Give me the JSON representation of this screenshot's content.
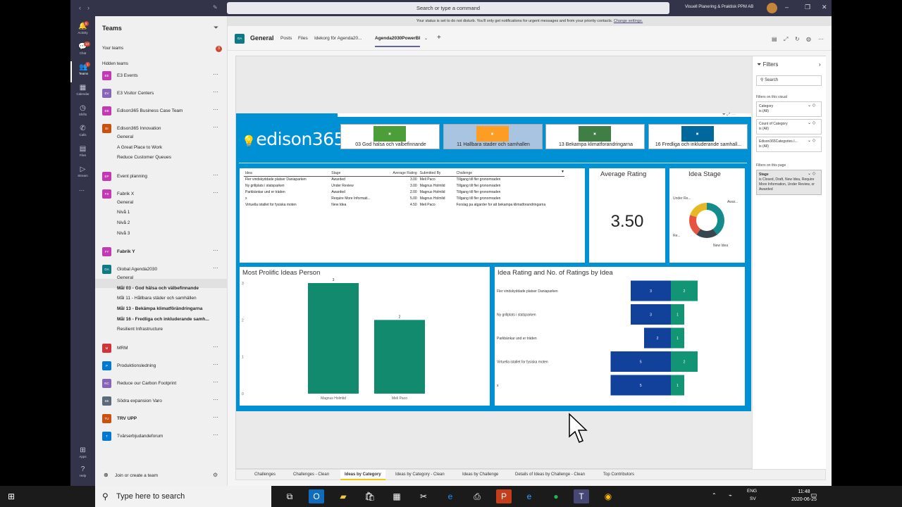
{
  "window": {
    "search_placeholder": "Search or type a command",
    "org": "Visuell Planering & Praktisk PPM AB"
  },
  "rail": [
    {
      "label": "Activity",
      "icon": "bell-icon",
      "badge": "5"
    },
    {
      "label": "Chat",
      "icon": "chat-icon",
      "badge": "12"
    },
    {
      "label": "Teams",
      "icon": "teams-icon",
      "badge": "1"
    },
    {
      "label": "Calendar",
      "icon": "calendar-icon",
      "badge": ""
    },
    {
      "label": "Shifts",
      "icon": "clock-icon",
      "badge": ""
    },
    {
      "label": "Calls",
      "icon": "phone-icon",
      "badge": ""
    },
    {
      "label": "Files",
      "icon": "file-icon",
      "badge": ""
    },
    {
      "label": "Stream",
      "icon": "stream-icon",
      "badge": ""
    }
  ],
  "rail_bottom": [
    {
      "label": "Apps",
      "icon": "apps-icon"
    },
    {
      "label": "Help",
      "icon": "help-icon"
    }
  ],
  "teams_panel": {
    "title": "Teams",
    "your_teams": "Your teams",
    "your_teams_badge": "3",
    "hidden_teams": "Hidden teams",
    "join": "Join or create a team",
    "teams": [
      {
        "name": "E3 Events",
        "abbr": "EE",
        "color": "#c239b3",
        "bold": false
      },
      {
        "name": "E3 Visitor Centers",
        "abbr": "EV",
        "color": "#8764b8",
        "bold": false
      },
      {
        "name": "Edison365 Business Case Team",
        "abbr": "EB",
        "color": "#c239b3",
        "bold": false
      },
      {
        "name": "Edison365 Innovation",
        "abbr": "EI",
        "color": "#ca5010",
        "bold": false,
        "channels": [
          {
            "name": "General",
            "bold": false
          },
          {
            "name": "A Great Place to Work",
            "bold": false
          },
          {
            "name": "Reduce Customer Queues",
            "bold": false
          }
        ]
      },
      {
        "name": "Event planning",
        "abbr": "EP",
        "color": "#c239b3",
        "bold": false
      },
      {
        "name": "Fabrik X",
        "abbr": "FX",
        "color": "#c239b3",
        "bold": false,
        "channels": [
          {
            "name": "General",
            "bold": false
          },
          {
            "name": "Nivå 1",
            "bold": false
          },
          {
            "name": "Nivå 2",
            "bold": false
          },
          {
            "name": "Nivå 3",
            "bold": false
          }
        ]
      },
      {
        "name": "Fabrik Y",
        "abbr": "FY",
        "color": "#c239b3",
        "bold": true
      },
      {
        "name": "Global Agenda2030",
        "abbr": "GA",
        "color": "#0e7a86",
        "bold": false,
        "channels": [
          {
            "name": "General",
            "bold": false,
            "selected": true
          },
          {
            "name": "Mål 03 - God hälsa och välbefinnande",
            "bold": true
          },
          {
            "name": "Mål 11 - Hållbara städer och samhällen",
            "bold": false
          },
          {
            "name": "Mål 13 - Bekämpa klimatförändringarna",
            "bold": true
          },
          {
            "name": "Mål 16 - Fredliga och inkluderande samh...",
            "bold": true
          },
          {
            "name": "Resilient Infrastructure",
            "bold": false
          }
        ]
      },
      {
        "name": "MRM",
        "abbr": "M",
        "color": "#d13438",
        "bold": false
      },
      {
        "name": "Produktionsledning",
        "abbr": "P",
        "color": "#0078d4",
        "bold": false
      },
      {
        "name": "Reduce our Carbon Footprint",
        "abbr": "RC",
        "color": "#8764b8",
        "bold": false
      },
      {
        "name": "Södra expansion Varo",
        "abbr": "SE",
        "color": "#5a6a7a",
        "bold": false
      },
      {
        "name": "TRV UPP",
        "abbr": "TU",
        "color": "#ca5010",
        "bold": true
      },
      {
        "name": "Tvärserbjudandeforum",
        "abbr": "T",
        "color": "#0078d4",
        "bold": false
      }
    ]
  },
  "notice": {
    "text": "Your status is set to do not disturb. You'll only get notifications for urgent messages and from your priority contacts.",
    "link": "Change settings."
  },
  "channel": {
    "abbr": "GA",
    "name": "General",
    "tabs": [
      "Posts",
      "Files",
      "Idekorg för Agenda20...",
      "Agenda2030PowerBI"
    ],
    "active_tab": "Agenda2030PowerBI"
  },
  "report": {
    "logo": "edison365",
    "goals": [
      {
        "label": "03 God halsa och valbefinnande",
        "color": "#4c9f38",
        "selected": false
      },
      {
        "label": "11 Hallbara stader och samhallen",
        "color": "#fd9d24",
        "selected": true
      },
      {
        "label": "13 Bekampa klimatforandringarna",
        "color": "#3f7e44",
        "selected": false
      },
      {
        "label": "16 Fredliga och inkluderande samhall...",
        "color": "#00689d",
        "selected": false
      }
    ],
    "table": {
      "headers": [
        "Idea",
        "Stage",
        "Average Rating",
        "Submitted By",
        "Challenge"
      ],
      "rows": [
        [
          "Fler vindskyddade platser Daniaparken",
          "Awarded",
          "3.00",
          "Meli Paco",
          "Tillgang till fler gronomraden"
        ],
        [
          "Ny grillplats i statsparken",
          "Under Review",
          "3.00",
          "Magnus Holmlid",
          "Tillgang till fler gronomraden"
        ],
        [
          "Parkbänkar und er träden",
          "Awarded",
          "2.00",
          "Magnus Holmlid",
          "Tillgang till fler gronomraden"
        ],
        [
          "x",
          "Require More Informati...",
          "5.00",
          "Magnus Holmlid",
          "Tillgang till fler gronomraden"
        ],
        [
          "Virtuella istallet for fysiska moten",
          "New Idea",
          "4.50",
          "Meli Paco",
          "Forslag pa atgarder for att bekampa klimatforandringarna"
        ]
      ]
    },
    "avg_rating": {
      "title": "Average Rating",
      "value": "3.50"
    },
    "idea_stage": {
      "title": "Idea Stage",
      "labels": [
        "Under Re...",
        "Awar...",
        "Re...",
        "New Idea"
      ]
    },
    "filters": {
      "title": "Filters",
      "search": "Search",
      "visual_section": "Filters on this visual",
      "visual_filters": [
        {
          "name": "Category",
          "value": "is (All)"
        },
        {
          "name": "Count of Category",
          "value": "is (All)"
        },
        {
          "name": "Edison365Categories.I...",
          "value": "is (All)"
        }
      ],
      "page_section": "Filters on this page",
      "page_filter": {
        "name": "Stage",
        "value": "is Closed, Draft, New Idea, Require More Information, Under Review, or Awarded"
      }
    },
    "page_tabs": [
      "Challenges",
      "Challenges - Clean",
      "Ideas by Category",
      "Ideas by Category - Clean",
      "Ideas by Challenge",
      "Details of Ideas by Challenge - Clean",
      "Top Contributors"
    ],
    "active_page": "Ideas by Category"
  },
  "chart_data": [
    {
      "type": "pie",
      "title": "Idea Stage",
      "categories": [
        "Awarded",
        "New Idea",
        "Re...",
        "Under Re..."
      ],
      "values": [
        2,
        1,
        1,
        1
      ],
      "colors": [
        "#148c8c",
        "#37474f",
        "#e8543e",
        "#e6b823"
      ]
    },
    {
      "type": "bar",
      "title": "Most Prolific Ideas Person",
      "categories": [
        "Magnus Holmlid",
        "Meli Paco"
      ],
      "values": [
        3,
        2
      ],
      "ylim": [
        0,
        3
      ],
      "yticks": [
        0,
        1,
        2,
        3
      ],
      "color": "#118a6e"
    },
    {
      "type": "bar",
      "orientation": "horizontal",
      "title": "Idea Rating and No. of Ratings by Idea",
      "categories": [
        "Fler vindskyddade platser Daniaparken",
        "Ny grillplats i statsparken",
        "Parkbänkar und er träden",
        "Virtuella istallet for fysiska moten",
        "x"
      ],
      "series": [
        {
          "values": [
            3,
            3,
            2,
            5,
            5
          ],
          "color": "#12419b"
        },
        {
          "values": [
            2,
            1,
            1,
            2,
            1
          ],
          "color": "#119575"
        }
      ]
    }
  ],
  "taskbar": {
    "search": "Type here to search",
    "lang": "ENG",
    "lang2": "SV",
    "time": "11:48",
    "date": "2020-06-25"
  }
}
